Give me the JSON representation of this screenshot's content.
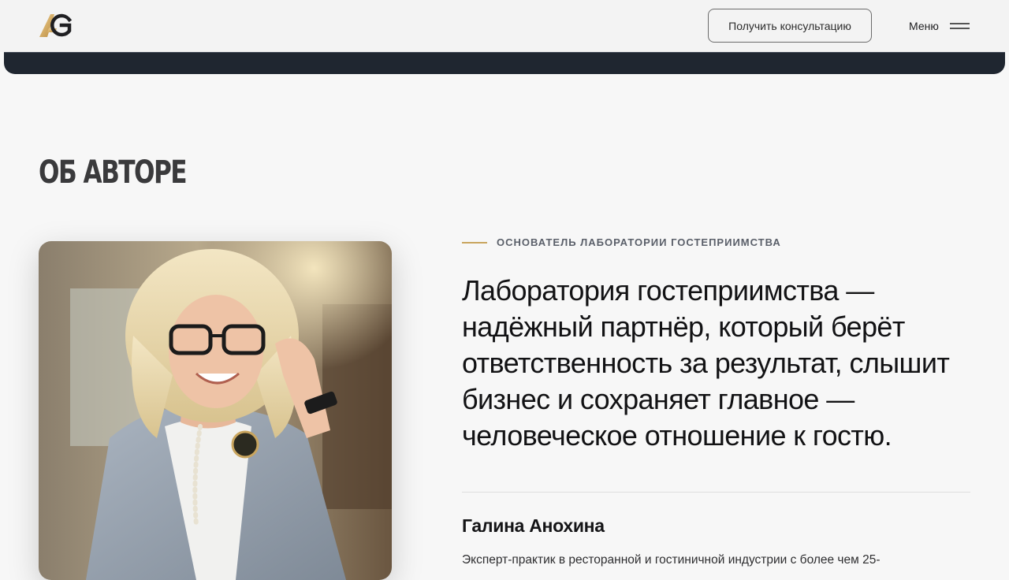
{
  "header": {
    "logo_text": "AG",
    "consult_label": "Получить консультацию",
    "menu_label": "Меню"
  },
  "about": {
    "section_title": "ОБ АВТОРЕ",
    "eyebrow": "ОСНОВАТЕЛЬ ЛАБОРАТОРИИ ГОСТЕПРИИМСТВА",
    "quote": "Лаборатория гостеприимства — надёжный партнёр, который берёт ответственность за результат, слышит бизнес и сохраняет главное — человеческое отношение к гостю.",
    "author_name": "Галина Анохина",
    "author_bio": "Эксперт-практик в ресторанной и гостиничной индустрии с более чем 25-"
  },
  "colors": {
    "accent_gold": "#c9a55e",
    "dark_band": "#1f2630",
    "background": "#f7f7f7"
  },
  "icons": {
    "menu": "hamburger-icon",
    "logo": "ag-logo-icon"
  }
}
